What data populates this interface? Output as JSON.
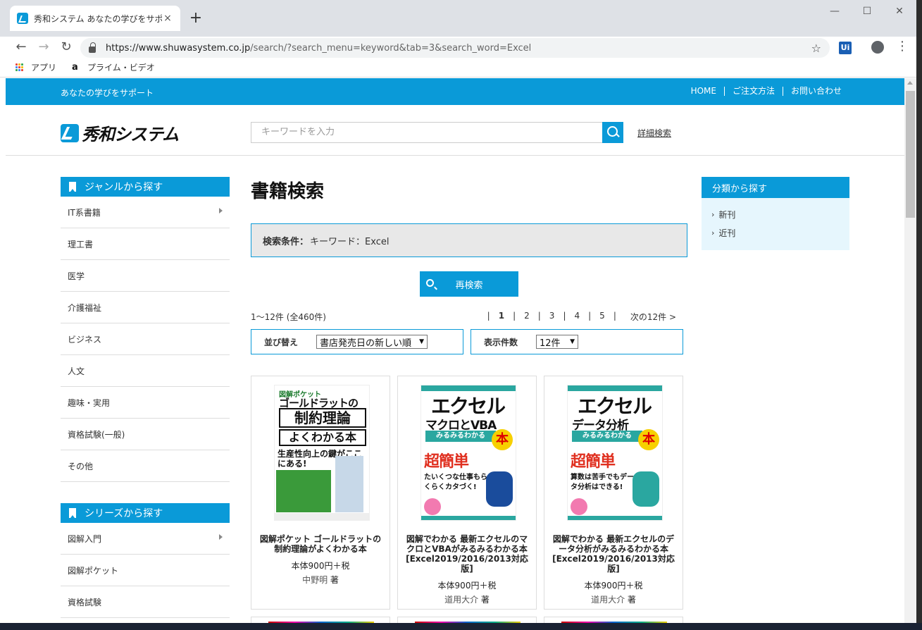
{
  "browser": {
    "tab_title": "秀和システム あなたの学びをサポート",
    "tab_close": "×",
    "new_tab": "+",
    "url_host": "https://www.shuwasystem.co.jp",
    "url_path": "/search/?search_menu=keyword&tab=3&search_word=Excel",
    "ext_label": "Ui",
    "bookmarks": [
      {
        "label": "アプリ"
      },
      {
        "label": "プライム・ビデオ"
      }
    ]
  },
  "site": {
    "tagline": "あなたの学びをサポート",
    "top_links": [
      "HOME",
      "ご注文方法",
      "お問い合わせ"
    ],
    "logo_text": "秀和システム",
    "search_placeholder": "キーワードを入力",
    "advanced_search": "詳細検索"
  },
  "genre": {
    "heading": "ジャンルから探す",
    "items": [
      {
        "label": "IT系書籍",
        "arrow": true
      },
      {
        "label": "理工書"
      },
      {
        "label": "医学"
      },
      {
        "label": "介護福祉"
      },
      {
        "label": "ビジネス"
      },
      {
        "label": "人文"
      },
      {
        "label": "趣味・実用"
      },
      {
        "label": "資格試験(一般)"
      },
      {
        "label": "その他"
      }
    ]
  },
  "series": {
    "heading": "シリーズから探す",
    "items": [
      {
        "label": "図解入門",
        "arrow": true
      },
      {
        "label": "図解ポケット"
      },
      {
        "label": "資格試験"
      }
    ]
  },
  "category": {
    "heading": "分類から探す",
    "items": [
      "新刊",
      "近刊"
    ]
  },
  "main": {
    "title": "書籍検索",
    "condition_label": "検索条件：",
    "condition_value": "キーワード：Excel",
    "research_button": "再検索",
    "result_count": "1〜12件 (全460件)",
    "pager": [
      "|",
      "1",
      "|",
      "2",
      "|",
      "3",
      "|",
      "4",
      "|",
      "5",
      "|",
      "次の12件 >"
    ],
    "sort_label": "並び替え",
    "sort_value": "書店発売日の新しい順",
    "per_page_label": "表示件数",
    "per_page_value": "12件"
  },
  "books": [
    {
      "title": "図解ポケット ゴールドラットの制約理論がよくわかる本",
      "price": "本体900円＋税",
      "author": "中野明",
      "author_suffix": "著",
      "cover": {
        "top": "図解ポケット",
        "line1": "ゴールドラットの",
        "line2": "制約理論",
        "line3": "よくわかる本",
        "sub": "生産性向上の鍵がここにある!"
      }
    },
    {
      "title": "図解でわかる 最新エクセルのマクロとVBAがみるみるわかる本 [Excel2019/2016/2013対応版]",
      "price": "本体900円＋税",
      "author": "道用大介",
      "author_suffix": "著",
      "cover": {
        "line1": "エクセル",
        "line2": "マクロとVBA",
        "line3": "みるみるわかる",
        "hon": "本",
        "red": "超簡単",
        "mid": "たいくつな仕事もらくらくカタづく!"
      }
    },
    {
      "title": "図解でわかる 最新エクセルのデータ分析がみるみるわかる本 [Excel2019/2016/2013対応版]",
      "price": "本体900円＋税",
      "author": "道用大介",
      "author_suffix": "著",
      "cover": {
        "line1": "エクセル",
        "line2": "データ分析",
        "line3": "みるみるわかる",
        "hon": "本",
        "red": "超簡単",
        "mid": "算数は苦手でもデータ分析はできる!"
      }
    }
  ],
  "colors": {
    "brand": "#0a9ad8",
    "brand_light": "#e6f6fd"
  }
}
